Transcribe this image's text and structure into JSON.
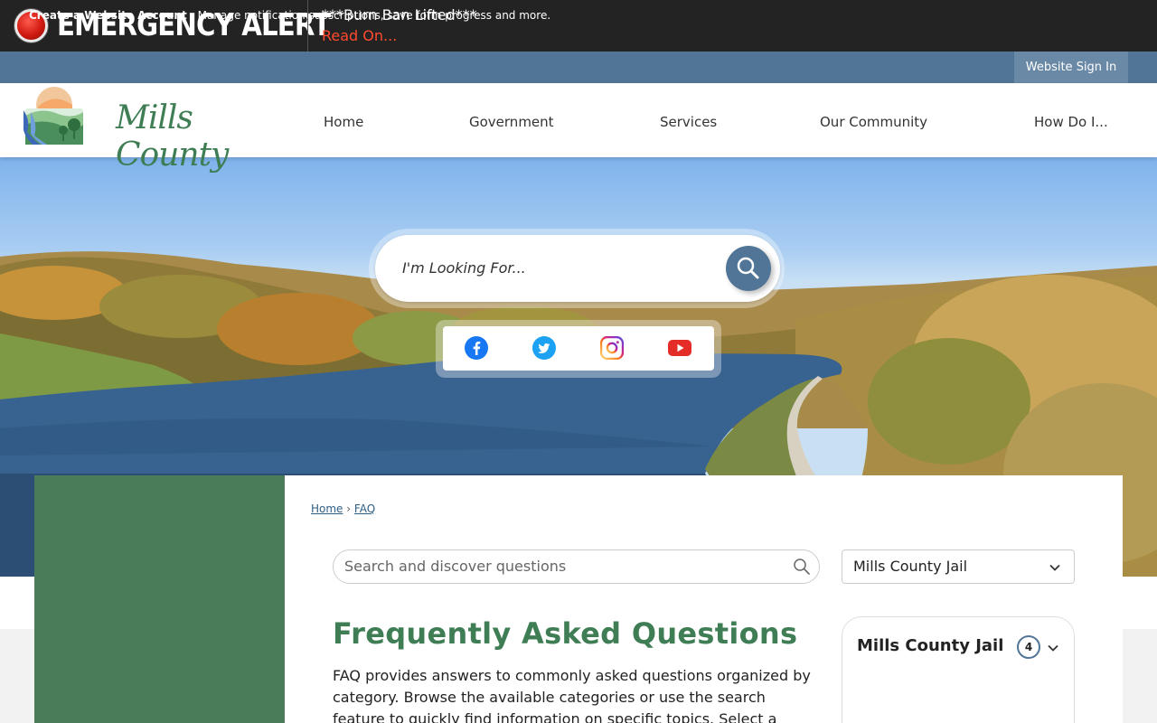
{
  "alert": {
    "title": "EMERGENCY ALERT",
    "message": "***Burn Ban Lifted***",
    "link": "Read On..."
  },
  "account_bar": {
    "create_label": "Create a Website Account",
    "description": " - Manage notification subscriptions, save form progress and more.",
    "signin_label": "Website Sign In"
  },
  "header": {
    "logo_text": "Mills County",
    "nav": [
      "Home",
      "Government",
      "Services",
      "Our Community",
      "How Do I..."
    ]
  },
  "hero": {
    "search_placeholder": "I'm Looking For...",
    "social": [
      "facebook-icon",
      "twitter-icon",
      "instagram-icon",
      "youtube-icon"
    ]
  },
  "breadcrumb": {
    "home": "Home",
    "separator": "›",
    "current": "FAQ"
  },
  "faq": {
    "search_placeholder": "Search and discover questions",
    "category_selected": "Mills County Jail",
    "title": "Frequently Asked Questions",
    "description": "FAQ provides answers to commonly asked questions organized by category. Browse the available categories or use the search feature to quickly find information on specific topics. Select a question to view its",
    "category_card": {
      "title": "Mills County Jail",
      "count": "4"
    }
  },
  "colors": {
    "alert_bg": "#232323",
    "account_bar": "#517596",
    "brand_green": "#3f7d55",
    "sidebar_green": "#4a7c59",
    "link_red": "#ff4a2e"
  }
}
